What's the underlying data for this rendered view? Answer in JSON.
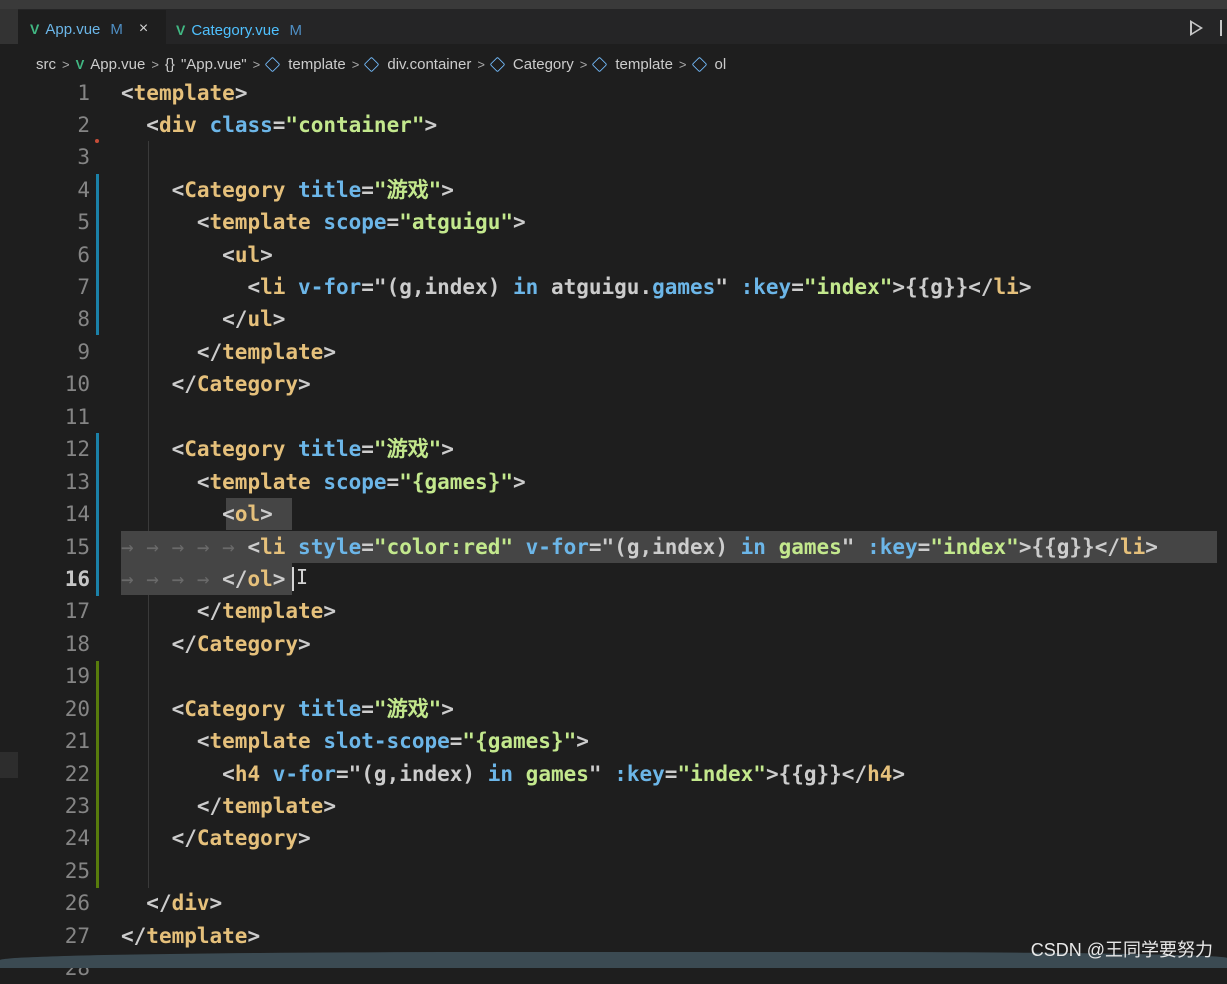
{
  "tabs": [
    {
      "name": "App.vue",
      "modified": "M",
      "close": "×",
      "active": true
    },
    {
      "name": "Category.vue",
      "modified": "M",
      "active": false
    }
  ],
  "breadcrumb": {
    "src": "src",
    "file": "App.vue",
    "braces": "{}",
    "app": "\"App.vue\"",
    "items": [
      "template",
      "div.container",
      "Category",
      "template",
      "ol"
    ]
  },
  "editor": {
    "current_line": 16,
    "line_numbers": [
      "1",
      "2",
      "3",
      "4",
      "5",
      "6",
      "7",
      "8",
      "9",
      "10",
      "11",
      "12",
      "13",
      "14",
      "15",
      "16",
      "17",
      "18",
      "19",
      "20",
      "21",
      "22",
      "23",
      "24",
      "25",
      "26",
      "27",
      "28"
    ]
  },
  "watermark": "CSDN @王同学要努力"
}
